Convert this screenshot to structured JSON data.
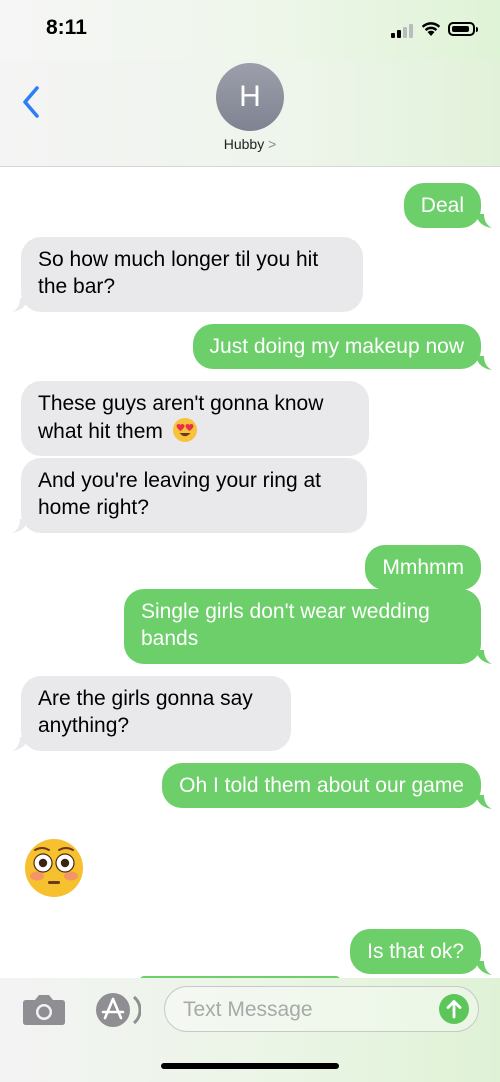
{
  "status_bar": {
    "time": "8:11"
  },
  "header": {
    "avatar_initial": "H",
    "contact_name": "Hubby",
    "chevron": ">"
  },
  "messages": [
    {
      "from": "me",
      "text": "Deal"
    },
    {
      "from": "them",
      "line1": "So how much longer til you hit",
      "line2": "the bar?"
    },
    {
      "from": "me",
      "text": "Just doing my makeup now"
    },
    {
      "from": "them",
      "line1": "These guys aren't gonna know",
      "line2": "what hit them"
    },
    {
      "from": "them",
      "line1": "And you're leaving your ring at",
      "line2": "home right?"
    },
    {
      "from": "me",
      "text": "Mmhmm"
    },
    {
      "from": "me",
      "line1": "Single girls don't wear wedding",
      "line2": "bands"
    },
    {
      "from": "them",
      "line1": "Are the girls gonna say",
      "line2": "anything?"
    },
    {
      "from": "me",
      "text": "Oh I told them about our game"
    },
    {
      "from": "them",
      "emoji": "flushed-face"
    },
    {
      "from": "me",
      "text": "Is that ok?"
    }
  ],
  "input": {
    "placeholder": "Text Message"
  },
  "colors": {
    "outgoing": "#6ccf6a",
    "incoming": "#e9e9eb",
    "accent": "#2f7ef6"
  },
  "icons": [
    "back-chevron-icon",
    "camera-icon",
    "app-store-icon",
    "send-arrow-icon",
    "heart-eyes-emoji",
    "flushed-face-emoji"
  ]
}
